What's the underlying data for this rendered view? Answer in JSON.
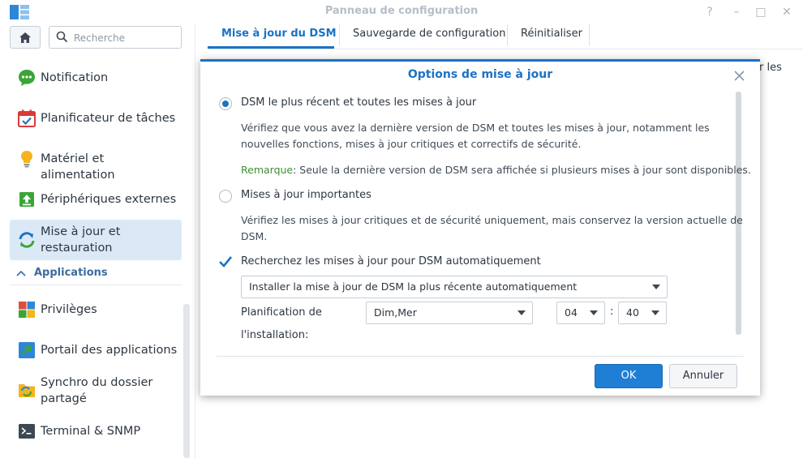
{
  "window": {
    "title": "Panneau de configuration",
    "controls": [
      "?",
      "–",
      "□",
      "✕"
    ]
  },
  "sidebar": {
    "search_placeholder": "Recherche",
    "items": [
      {
        "label": "Notification",
        "icon": "notification-icon"
      },
      {
        "label": "Planificateur de tâches",
        "icon": "task-scheduler-icon"
      },
      {
        "label": "Matériel et alimentation",
        "icon": "hardware-power-icon"
      },
      {
        "label": "Périphériques externes",
        "icon": "external-devices-icon"
      },
      {
        "label_line1": "Mise à jour et",
        "label_line2": "restauration",
        "icon": "update-restore-icon",
        "active": true
      }
    ],
    "section": "Applications",
    "app_items": [
      {
        "label": "Privilèges",
        "icon": "privileges-icon"
      },
      {
        "label": "Portail des applications",
        "icon": "application-portal-icon"
      },
      {
        "label_line1": "Synchro du dossier",
        "label_line2": "partagé",
        "icon": "shared-folder-sync-icon"
      },
      {
        "label": "Terminal & SNMP",
        "icon": "terminal-snmp-icon"
      }
    ]
  },
  "tabs": [
    {
      "label": "Mise à jour du DSM",
      "active": true
    },
    {
      "label": "Sauvegarde de configuration"
    },
    {
      "label": "Réinitialiser"
    }
  ],
  "background_text": "r les",
  "dialog": {
    "title": "Options de mise à jour",
    "option1": {
      "label": "DSM le plus récent et toutes les mises à jour",
      "selected": true,
      "desc_line1": "Vérifiez que vous avez la dernière version de DSM et toutes les mises à jour, notamment les",
      "desc_line2": "nouvelles fonctions, mises à jour critiques et correctifs de sécurité.",
      "remark_key": "Remarque",
      "remark_text": ": Seule la dernière version de DSM sera affichée si plusieurs mises à jour sont disponibles."
    },
    "option2": {
      "label": "Mises à jour importantes",
      "selected": false,
      "desc_line1": "Vérifiez les mises à jour critiques et de sécurité uniquement, mais conservez la version actuelle de",
      "desc_line2": "DSM."
    },
    "auto_check": {
      "label": "Recherchez les mises à jour pour DSM automatiquement",
      "checked": true
    },
    "auto_install_select": "Installer la mise à jour de DSM la plus récente automatiquement",
    "schedule": {
      "label_line1": "Planification de",
      "label_line2": "l'installation:",
      "days": "Dim,Mer",
      "hour": "04",
      "separator": ":",
      "minute": "40"
    },
    "ok_label": "OK",
    "cancel_label": "Annuler"
  },
  "colors": {
    "accent": "#1c72c4",
    "remark": "#3e8f32",
    "active_nav": "#dbe9f7"
  }
}
